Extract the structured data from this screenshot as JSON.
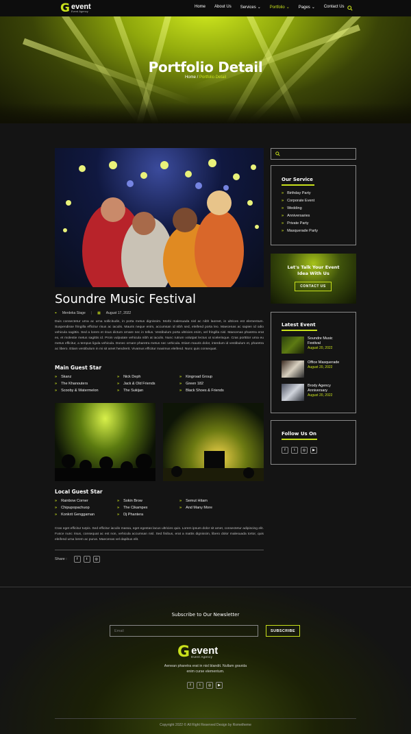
{
  "nav": {
    "logo_letter": "G",
    "logo_word": "event",
    "logo_sub": "Event Agency",
    "links": [
      "Home",
      "About Us",
      "Services",
      "Portfolio",
      "Pages",
      "Contact Us"
    ]
  },
  "hero": {
    "title": "Portfolio Detail",
    "crumb_home": "Home",
    "crumb_sep": "/",
    "crumb_current": "Portfolio Detail"
  },
  "article": {
    "title": "Soundre Music Festival",
    "location": "Merdeka Stage",
    "date": "August 17, 2022",
    "para1": "Duis consectetur urna ac urna sollicitudin, in porta metus dignissim. Morbi malesuada nisl ac nibh laoreet, in ultrices est elementum. Suspendisse fringilla efficitur risus ac iaculis. Mauris neque enim, accumsan id nibh sed, eleifend porta leo. Maecenas ac sapien id odio vehicula sagittis. Sed a lorem et risus dictum ornare nec in tellus. Vestibulum porta ultricies enim, vel fringilla nisl. Maecenas pharetra erat ex, et molestie metus sagittis id. Proin vulputate vehicula nibh at iaculis. Nunc rutrum volutpat lectus ut scelerisque. Cras porttitor urna eu metus efficitur, a tempus ligula vehicula. Donec ornare pharetra metus nec vehicula. Etiam mauris dolor, interdum id vestibulum et, pharetra ac libero. Etiam vestibulum in mi sit amet hendrerit. Vivamus efficitur maximus eleifend. Nunc quis consequat.",
    "main_guest_title": "Main Guest Star",
    "main_guests": [
      "Skanz",
      "Nick Deph",
      "Kingroad Group",
      "The Khanouters",
      "Jack & Old Friends",
      "Green 182",
      "Scooby & Watermelon",
      "The Sukijan",
      "Black Shoes & Friends"
    ],
    "local_guest_title": "Local Guest Star",
    "local_guests": [
      "Rainbow Corner",
      "Sokin Brow",
      "Semut Hitam",
      "Chipupopachuop",
      "The Cikampex",
      "And Many More",
      "Konkrit Genggaman",
      "Dj Phantera"
    ],
    "para2": "Cras eget efficitur turpis. Sed efficitur iaculis massa, eget egestas lacus ultricies quis. Lorem ipsum dolor sit amet, consectetur adipiscing elit. Fusce nunc risus, consequat ac est non, vehicula accumsan nisl. Sed finibus, erat a mattis dignissim, libero dolor malesuada tortor, quis eleifend urna lorem ac purus. Maecenas vel dapibus elit.",
    "share_label": "Share :"
  },
  "sidebar": {
    "service_title": "Our Service",
    "services": [
      "Birthday Party",
      "Corporate Event",
      "Wedding",
      "Anniversaries",
      "Private Party",
      "Masquerade Party"
    ],
    "cta_title": "Let's Talk Your Event Idea With Us",
    "cta_button": "CONTACT US",
    "latest_title": "Latest Event",
    "latest": [
      {
        "title": "Soundre Music Festival",
        "date": "August 20, 2022"
      },
      {
        "title": "Office Masquerade",
        "date": "August 20, 2022"
      },
      {
        "title": "Brody Agency Anniversary",
        "date": "August 20, 2022"
      }
    ],
    "follow_title": "Follow Us On"
  },
  "footer": {
    "newsletter_title": "Subscribe to Our Newsletter",
    "email_placeholder": "Email",
    "subscribe": "SUBSCRIBE",
    "about": "Aenean pharetra erat in nisl blandit. Nullam gravida enim curse elementum.",
    "copyright": "Copyright 2022 © All Right Reserved Design by Rometheme"
  },
  "colors": {
    "accent": "#c9e11c",
    "bg": "#141414"
  }
}
